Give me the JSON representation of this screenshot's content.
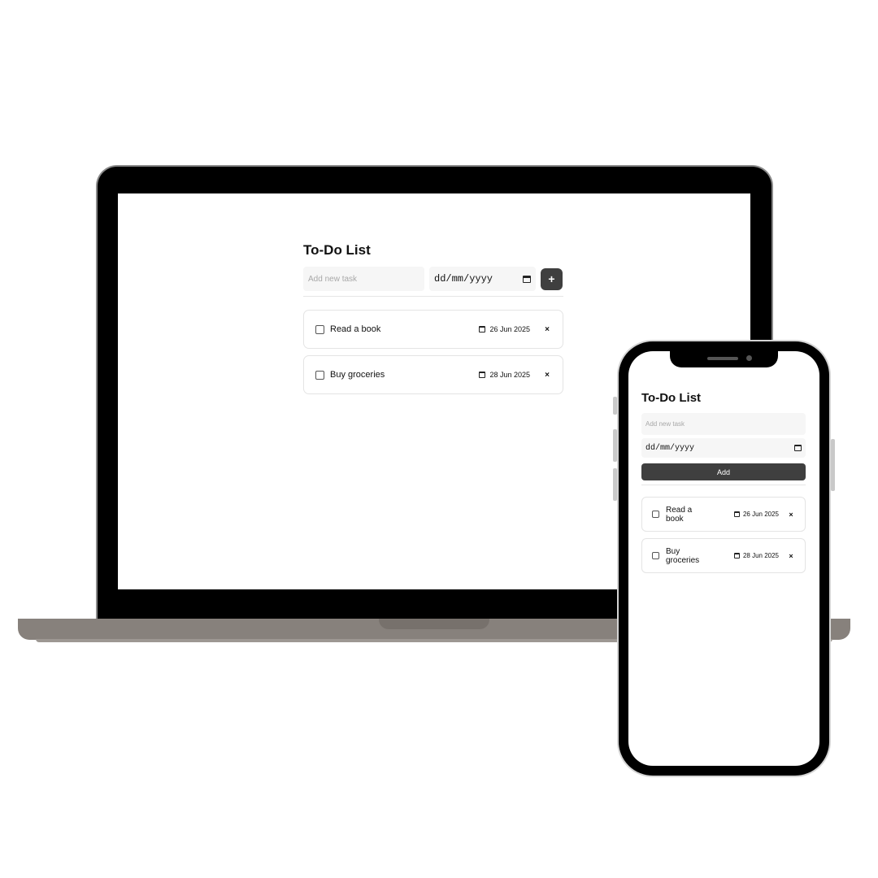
{
  "app": {
    "title": "To-Do List",
    "input_placeholder": "Add new task",
    "date_placeholder": "dd/mm/yyyy",
    "add_icon_label": "+",
    "add_button_label": "Add",
    "delete_glyph": "×",
    "icons": {
      "calendar": "calendar-icon",
      "delete": "close-icon",
      "checkbox": "checkbox"
    },
    "tasks": [
      {
        "text": "Read a book",
        "due": "26 Jun 2025",
        "done": false
      },
      {
        "text": "Buy groceries",
        "due": "28 Jun 2025",
        "done": false
      }
    ]
  },
  "colors": {
    "add_button": "#3f3f3f",
    "input_bg": "#f6f6f6",
    "device_frame": "#000000",
    "laptop_base": "#87817c"
  }
}
